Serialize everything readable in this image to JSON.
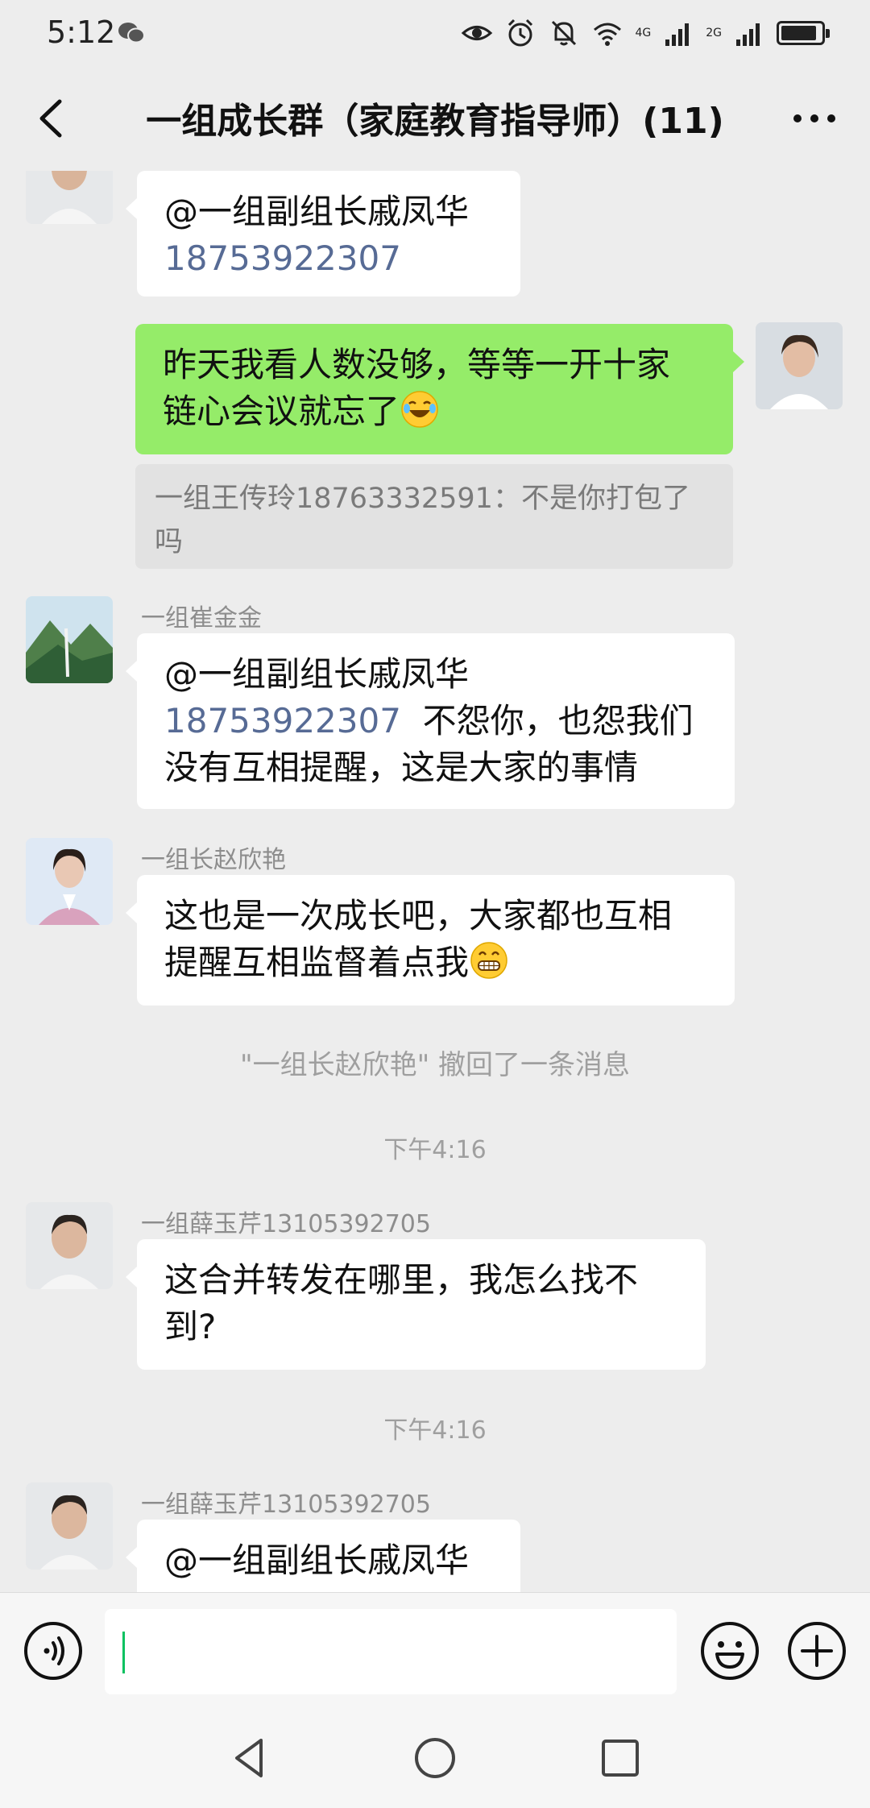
{
  "status": {
    "time": "5:12",
    "network_1": "4G",
    "network_2": "2G"
  },
  "header": {
    "title": "一组成长群（家庭教育指导师）(11)"
  },
  "messages": {
    "m1": {
      "line1": "@一组副组长戚凤华",
      "line2": "18753922307"
    },
    "m2": {
      "line1": "昨天我看人数没够，等等一开十家",
      "line2": "链心会议就忘了"
    },
    "m2_quote": "一组王传玲18763332591：不是你打包了吗",
    "m3": {
      "sender": "一组崔金金",
      "line1": "@一组副组长戚凤华",
      "number": "18753922307",
      "line2_rest": "不怨你，也怨我们",
      "line3": "没有互相提醒，这是大家的事情"
    },
    "m4": {
      "sender": "一组长赵欣艳",
      "line1": "这也是一次成长吧，大家都也互相",
      "line2": "提醒互相监督着点我"
    },
    "recall_note": "\"一组长赵欣艳\" 撤回了一条消息",
    "time1": "下午4:16",
    "m5": {
      "sender": "一组薛玉芹13105392705",
      "line1": "这合并转发在哪里，我怎么找不",
      "line2": "到?"
    },
    "time2": "下午4:16",
    "m6": {
      "sender": "一组薛玉芹13105392705",
      "line1": "@一组副组长戚凤华"
    }
  },
  "input": {
    "value": ""
  },
  "icons": {
    "back": "back-arrow-icon",
    "more": "more-dots-icon",
    "voice": "voice-icon",
    "emoji": "emoji-icon",
    "plus": "plus-icon",
    "nav_back": "nav-back-icon",
    "nav_home": "nav-home-icon",
    "nav_recent": "nav-recent-icon"
  },
  "colors": {
    "self_bubble": "#95ec69",
    "mention_number": "#576b95",
    "caret": "#07c160"
  }
}
